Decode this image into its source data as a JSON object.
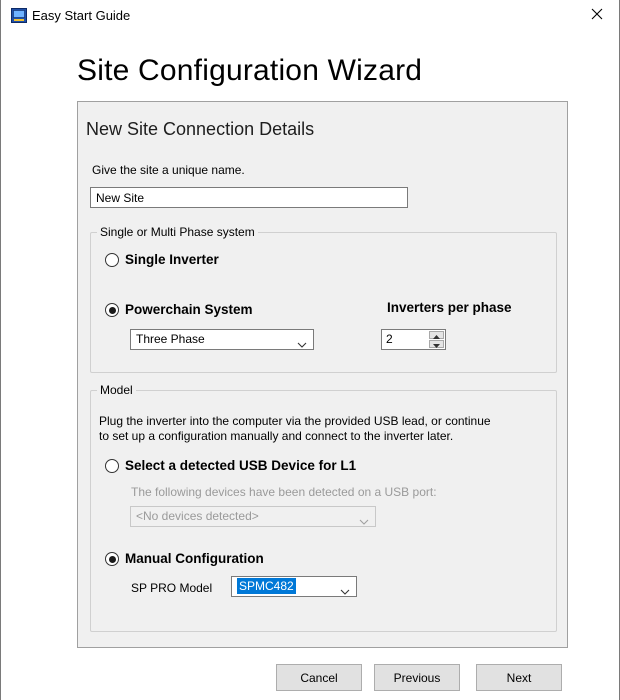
{
  "window": {
    "title": "Easy Start Guide"
  },
  "wizard": {
    "heading": "Site Configuration Wizard"
  },
  "connection": {
    "title": "New Site Connection Details",
    "name_prompt": "Give the site a unique name.",
    "name_value": "New Site"
  },
  "phase_group": {
    "legend": "Single or Multi Phase system",
    "single_label": "Single Inverter",
    "single_checked": false,
    "powerchain_label": "Powerchain System",
    "powerchain_checked": true,
    "phase_select": {
      "value": "Three Phase"
    },
    "inverters_label": "Inverters per phase",
    "inverters_value": "2"
  },
  "model_group": {
    "legend": "Model",
    "description_line1": "Plug the inverter into the computer via the provided USB lead, or continue",
    "description_line2": "to set up a configuration manually and connect to the inverter later.",
    "usb_label": "Select a detected USB Device for L1",
    "usb_checked": false,
    "usb_hint": "The following devices have been detected on a USB port:",
    "usb_select": {
      "value": "<No devices detected>"
    },
    "manual_label": "Manual Configuration",
    "manual_checked": true,
    "model_label": "SP PRO Model",
    "model_select": {
      "value": "SPMC482"
    }
  },
  "footer": {
    "cancel": "Cancel",
    "previous": "Previous",
    "next": "Next"
  },
  "colors": {
    "accent": "#0078d7",
    "panel_bg": "#f0f0f0",
    "disabled_text": "#9a9a9a"
  },
  "icons": {
    "app": "monitor-icon",
    "close": "close-icon",
    "dropdown": "chevron-down-icon",
    "spin_up": "triangle-up-icon",
    "spin_down": "triangle-down-icon"
  }
}
